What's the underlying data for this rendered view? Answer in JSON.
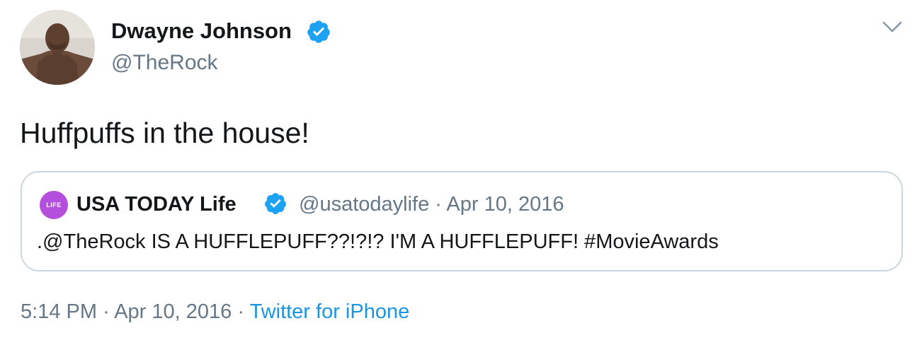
{
  "tweet": {
    "author": {
      "name": "Dwayne Johnson",
      "handle": "@TheRock",
      "verified": true
    },
    "text": "Huffpuffs in the house!",
    "quoted": {
      "avatar_label": "LIFE",
      "name": "USA TODAY Life",
      "verified": true,
      "meta": "@usatodaylife · Apr 10, 2016",
      "text": ".@TheRock IS A HUFFLEPUFF??!?!? I'M A HUFFLEPUFF! #MovieAwards"
    },
    "footer": {
      "time": "5:14 PM",
      "date": "Apr 10, 2016",
      "separator": "·",
      "source": "Twitter for iPhone"
    }
  },
  "icons": {
    "verified": "verified-badge-icon",
    "menu": "chevron-down-icon"
  },
  "colors": {
    "text_primary": "#14171a",
    "text_secondary": "#657786",
    "link": "#1b95e0",
    "verified": "#1da1f2",
    "quote_border": "#ccd6dd",
    "quoted_avatar": "#b34fdc"
  }
}
